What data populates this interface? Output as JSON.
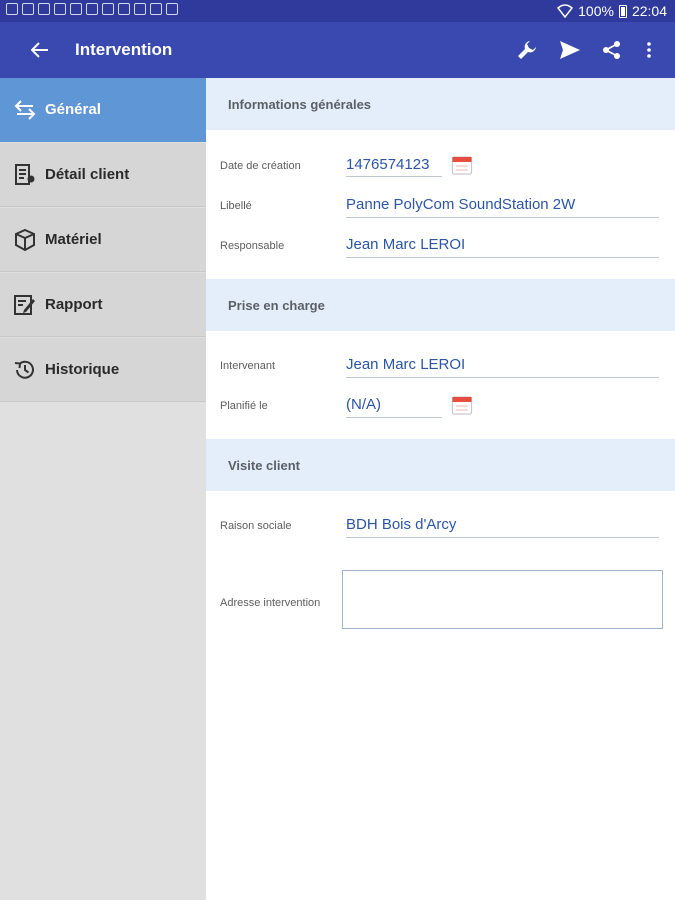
{
  "statusbar": {
    "battery": "100%",
    "time": "22:04"
  },
  "appbar": {
    "title": "Intervention"
  },
  "sidebar": {
    "items": [
      {
        "label": "Général",
        "icon": "swap-icon",
        "active": true
      },
      {
        "label": "Détail client",
        "icon": "client-detail-icon",
        "active": false
      },
      {
        "label": "Matériel",
        "icon": "box-icon",
        "active": false
      },
      {
        "label": "Rapport",
        "icon": "edit-report-icon",
        "active": false
      },
      {
        "label": "Historique",
        "icon": "history-icon",
        "active": false
      }
    ]
  },
  "sections": {
    "general": {
      "title": "Informations générales",
      "date_label": "Date de création",
      "date_value": "1476574123",
      "libelle_label": "Libellé",
      "libelle_value": "Panne PolyCom SoundStation 2W",
      "responsable_label": "Responsable",
      "responsable_value": "Jean Marc LEROI"
    },
    "prise": {
      "title": "Prise en charge",
      "intervenant_label": "Intervenant",
      "intervenant_value": "Jean Marc LEROI",
      "planifie_label": "Planifié le",
      "planifie_value": "(N/A)"
    },
    "visite": {
      "title": "Visite client",
      "raison_label": "Raison sociale",
      "raison_value": "BDH Bois d'Arcy",
      "adresse_label": "Adresse intervention",
      "adresse_value": ""
    }
  },
  "colors": {
    "statusbar": "#2f3a9c",
    "appbar": "#3949b0",
    "active_nav": "#5f96d6",
    "section_header": "#e4eefa",
    "value_text": "#2b55a8"
  }
}
